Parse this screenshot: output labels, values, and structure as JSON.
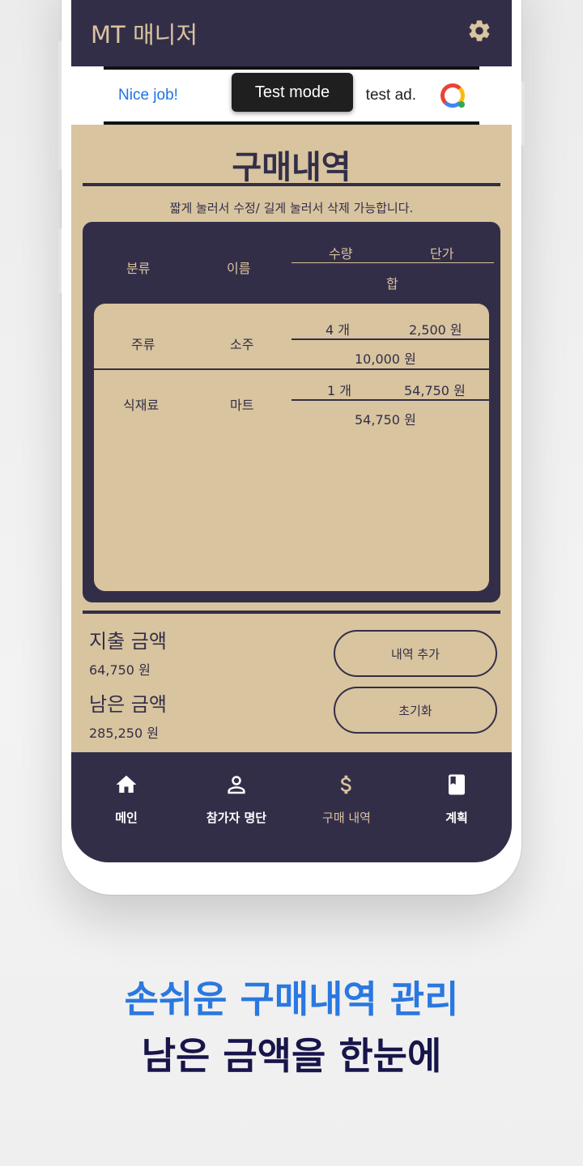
{
  "app": {
    "title": "MT 매니저"
  },
  "ad": {
    "left_text": "Nice job!",
    "right_text": "test ad.",
    "toast": "Test mode"
  },
  "page": {
    "title": "구매내역",
    "hint": "짧게 눌러서 수정/ 길게 눌러서 삭제 가능합니다."
  },
  "table": {
    "headers": {
      "category": "분류",
      "name": "이름",
      "qty": "수량",
      "price": "단가",
      "total": "합"
    },
    "rows": [
      {
        "category": "주류",
        "name": "소주",
        "qty": "4 개",
        "price": "2,500 원",
        "total": "10,000 원"
      },
      {
        "category": "식재료",
        "name": "마트",
        "qty": "1 개",
        "price": "54,750 원",
        "total": "54,750 원"
      }
    ]
  },
  "summary": {
    "spent_label": "지출 금액",
    "spent_value": "64,750 원",
    "remaining_label": "남은 금액",
    "remaining_value": "285,250 원",
    "add_button": "내역 추가",
    "reset_button": "초기화"
  },
  "nav": {
    "items": [
      {
        "label": "메인",
        "icon": "home-icon"
      },
      {
        "label": "참가자 명단",
        "icon": "person-icon"
      },
      {
        "label": "구매 내역",
        "icon": "dollar-icon"
      },
      {
        "label": "계획",
        "icon": "book-icon"
      }
    ],
    "active_index": 2
  },
  "promo": {
    "line1": "손쉬운 구매내역 관리",
    "line2": "남은 금액을 한눈에"
  },
  "colors": {
    "primary": "#332e48",
    "accent": "#d8c49f",
    "promo_blue": "#2a78e0",
    "promo_navy": "#17154a"
  }
}
